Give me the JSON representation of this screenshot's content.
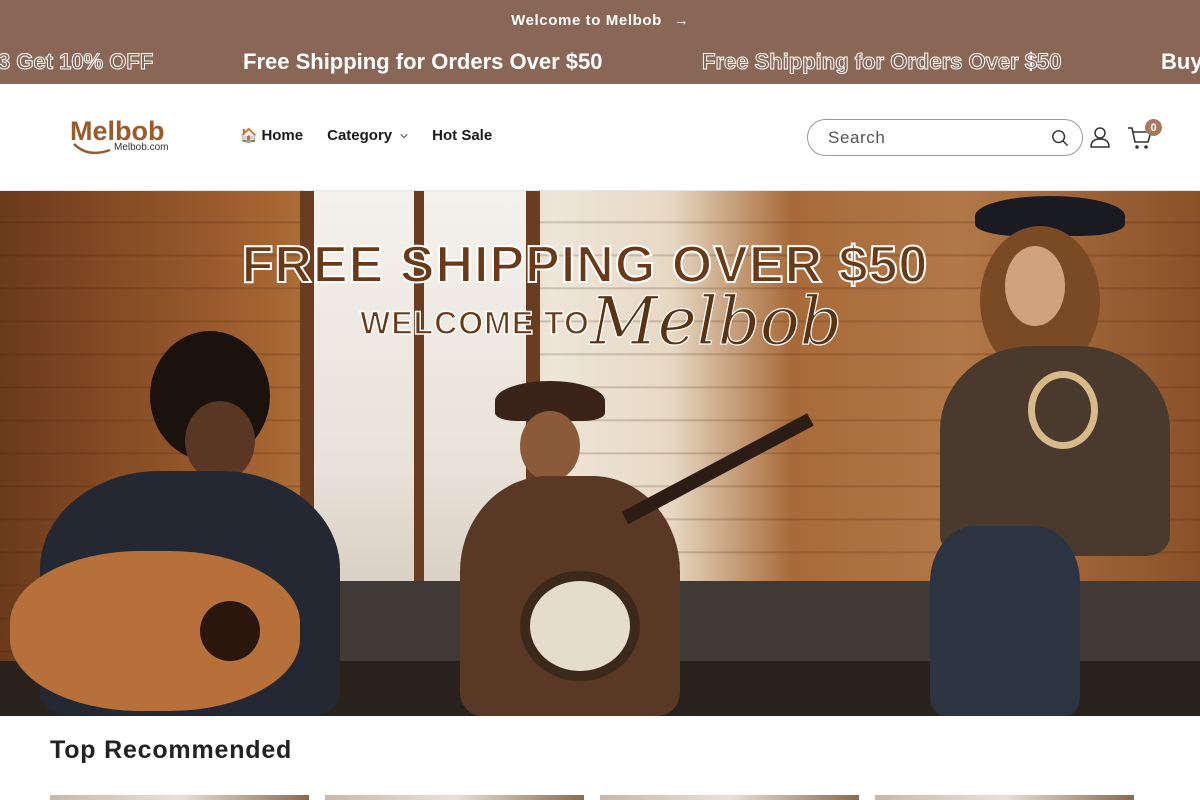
{
  "announcement": {
    "text": "Welcome to Melbob",
    "arrow": "→"
  },
  "marquee": {
    "items": [
      {
        "text": "3 Get 10% OFF",
        "style": "outline"
      },
      {
        "text": "Free Shipping for Orders Over $50",
        "style": "solid"
      },
      {
        "text": "Free Shipping for Orders Over $50",
        "style": "outline"
      },
      {
        "text": "Buy",
        "style": "solid"
      }
    ]
  },
  "header": {
    "logo": {
      "name": "Melbob",
      "domain": "Melbob.com"
    },
    "nav": [
      {
        "label": "Home",
        "icon": "home-icon"
      },
      {
        "label": "Category",
        "icon": "chevron-down-icon"
      },
      {
        "label": "Hot Sale"
      }
    ],
    "search": {
      "placeholder": "Search",
      "icon": "search-icon"
    },
    "account_icon": "account-icon",
    "cart": {
      "icon": "cart-icon",
      "count": "0"
    }
  },
  "hero": {
    "headline": "FREE SHIPPING OVER $50",
    "welcome": "WELCOME TO",
    "brand_script": "Melbob"
  },
  "section": {
    "title": "Top Recommended"
  },
  "colors": {
    "brand": "#8a6656",
    "accent_badge": "#a8785f",
    "logo_brown": "#9c5a2a"
  }
}
